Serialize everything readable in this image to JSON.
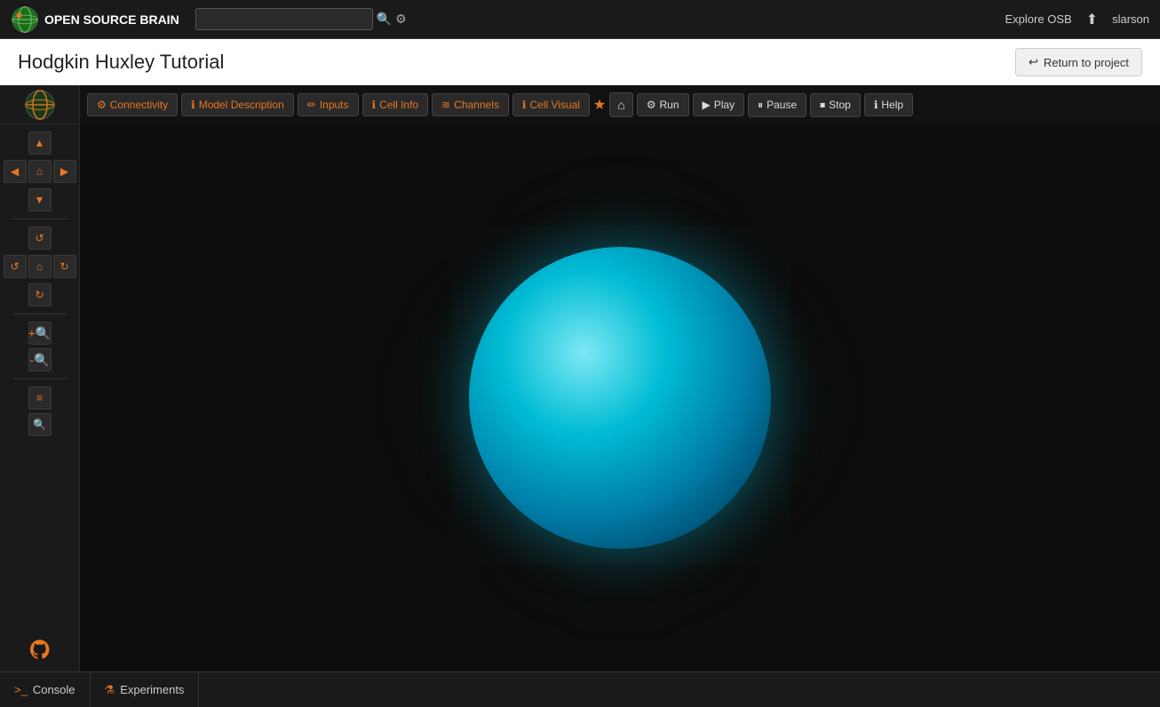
{
  "navbar": {
    "logo_text": "OPEN SOURCE BRAIN",
    "search_placeholder": "",
    "explore_osb": "Explore OSB",
    "user": "slarson"
  },
  "project": {
    "title": "Hodgkin Huxley Tutorial",
    "return_btn": "Return to project"
  },
  "tabs": [
    {
      "label": "Connectivity",
      "icon": "⚙"
    },
    {
      "label": "Model Description",
      "icon": "ℹ"
    },
    {
      "label": "Inputs",
      "icon": "✏"
    },
    {
      "label": "Cell Info",
      "icon": "ℹ"
    },
    {
      "label": "Channels",
      "icon": "≋"
    },
    {
      "label": "Cell Visual",
      "icon": "ℹ"
    }
  ],
  "action_buttons": {
    "run": "Run",
    "play": "Play",
    "pause": "Pause",
    "stop": "Stop",
    "help": "Help"
  },
  "sidebar": {
    "nav_arrows": {
      "up": "▲",
      "down": "▼",
      "left": "◀",
      "right": "▶",
      "home": "⌂"
    },
    "controls": {
      "undo": "↺",
      "home2": "⌂",
      "redo": "↻",
      "rotate": "↻",
      "zoom_in": "🔍+",
      "zoom_out": "🔍-",
      "list": "≡",
      "search": "🔍"
    }
  },
  "bottom_tabs": [
    {
      "label": "Console",
      "icon": ">_"
    },
    {
      "label": "Experiments",
      "icon": "⚗"
    }
  ]
}
